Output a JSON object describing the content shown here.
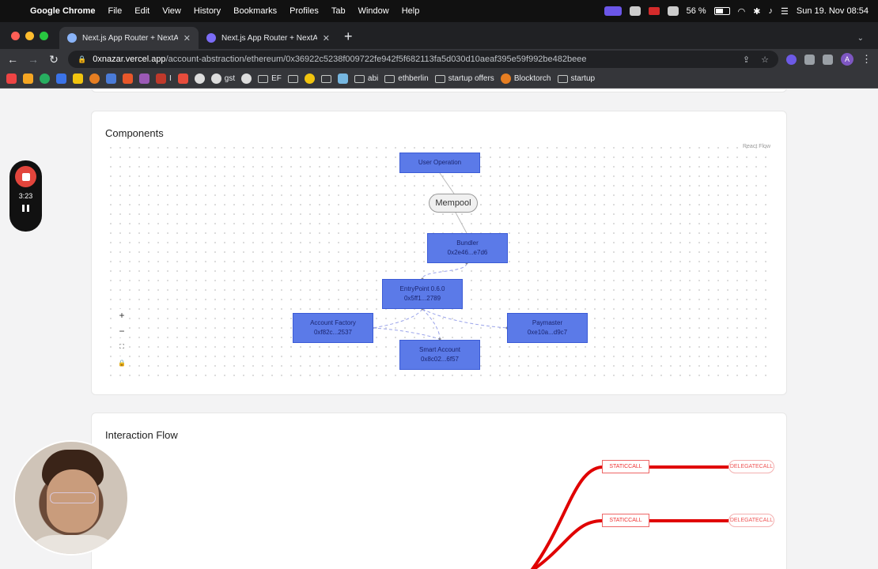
{
  "menubar": {
    "app": "Google Chrome",
    "items": [
      "File",
      "Edit",
      "View",
      "History",
      "Bookmarks",
      "Profiles",
      "Tab",
      "Window",
      "Help"
    ],
    "battery": "56 %",
    "datetime": "Sun 19. Nov  08:54"
  },
  "tabs": [
    {
      "title": "Next.js App Router + NextAuth",
      "active": true
    },
    {
      "title": "Next.js App Router + NextAuth",
      "active": false
    }
  ],
  "toolbar": {
    "url_host": "0xnazar.vercel.app",
    "url_path": "/account-abstraction/ethereum/0x36922c5238f009722fe942f5f682113fa5d030d10aeaf395e59f992be482beee",
    "avatar_letter": "A"
  },
  "bookmarks": [
    {
      "label": "I",
      "type": "icon"
    },
    {
      "label": "gst",
      "type": "icon"
    },
    {
      "label": "EF",
      "type": "folder"
    },
    {
      "label": "abi",
      "type": "folder"
    },
    {
      "label": "ethberlin",
      "type": "folder"
    },
    {
      "label": "startup offers",
      "type": "folder"
    },
    {
      "label": "Blocktorch",
      "type": "icon"
    },
    {
      "label": "startup",
      "type": "folder"
    }
  ],
  "components": {
    "title": "Components",
    "attribution": "React Flow",
    "nodes": {
      "user_operation": {
        "label": "User Operation"
      },
      "mempool": {
        "label": "Mempool"
      },
      "bundler": {
        "label": "Bundler",
        "address": "0x2e46...e7d6"
      },
      "entrypoint": {
        "label": "EntryPoint 0.6.0",
        "address": "0x5ff1...2789"
      },
      "account_factory": {
        "label": "Account Factory",
        "address": "0xf82c...2537"
      },
      "paymaster": {
        "label": "Paymaster",
        "address": "0xe10a...d9c7"
      },
      "smart_account": {
        "label": "Smart Account",
        "address": "0x8c02...6f57"
      }
    },
    "controls": [
      "+",
      "−",
      "⛶",
      "🔒"
    ]
  },
  "interaction_flow": {
    "title": "Interaction Flow",
    "calls": [
      {
        "type": "STATICCALL",
        "next": "DELEGATECALL"
      },
      {
        "type": "STATICCALL",
        "next": "DELEGATECALL"
      }
    ]
  },
  "recorder": {
    "time": "3:23"
  },
  "colors": {
    "node_fill": "#5b7ae8",
    "flow_red": "#e00000",
    "record_red": "#e2453c"
  }
}
